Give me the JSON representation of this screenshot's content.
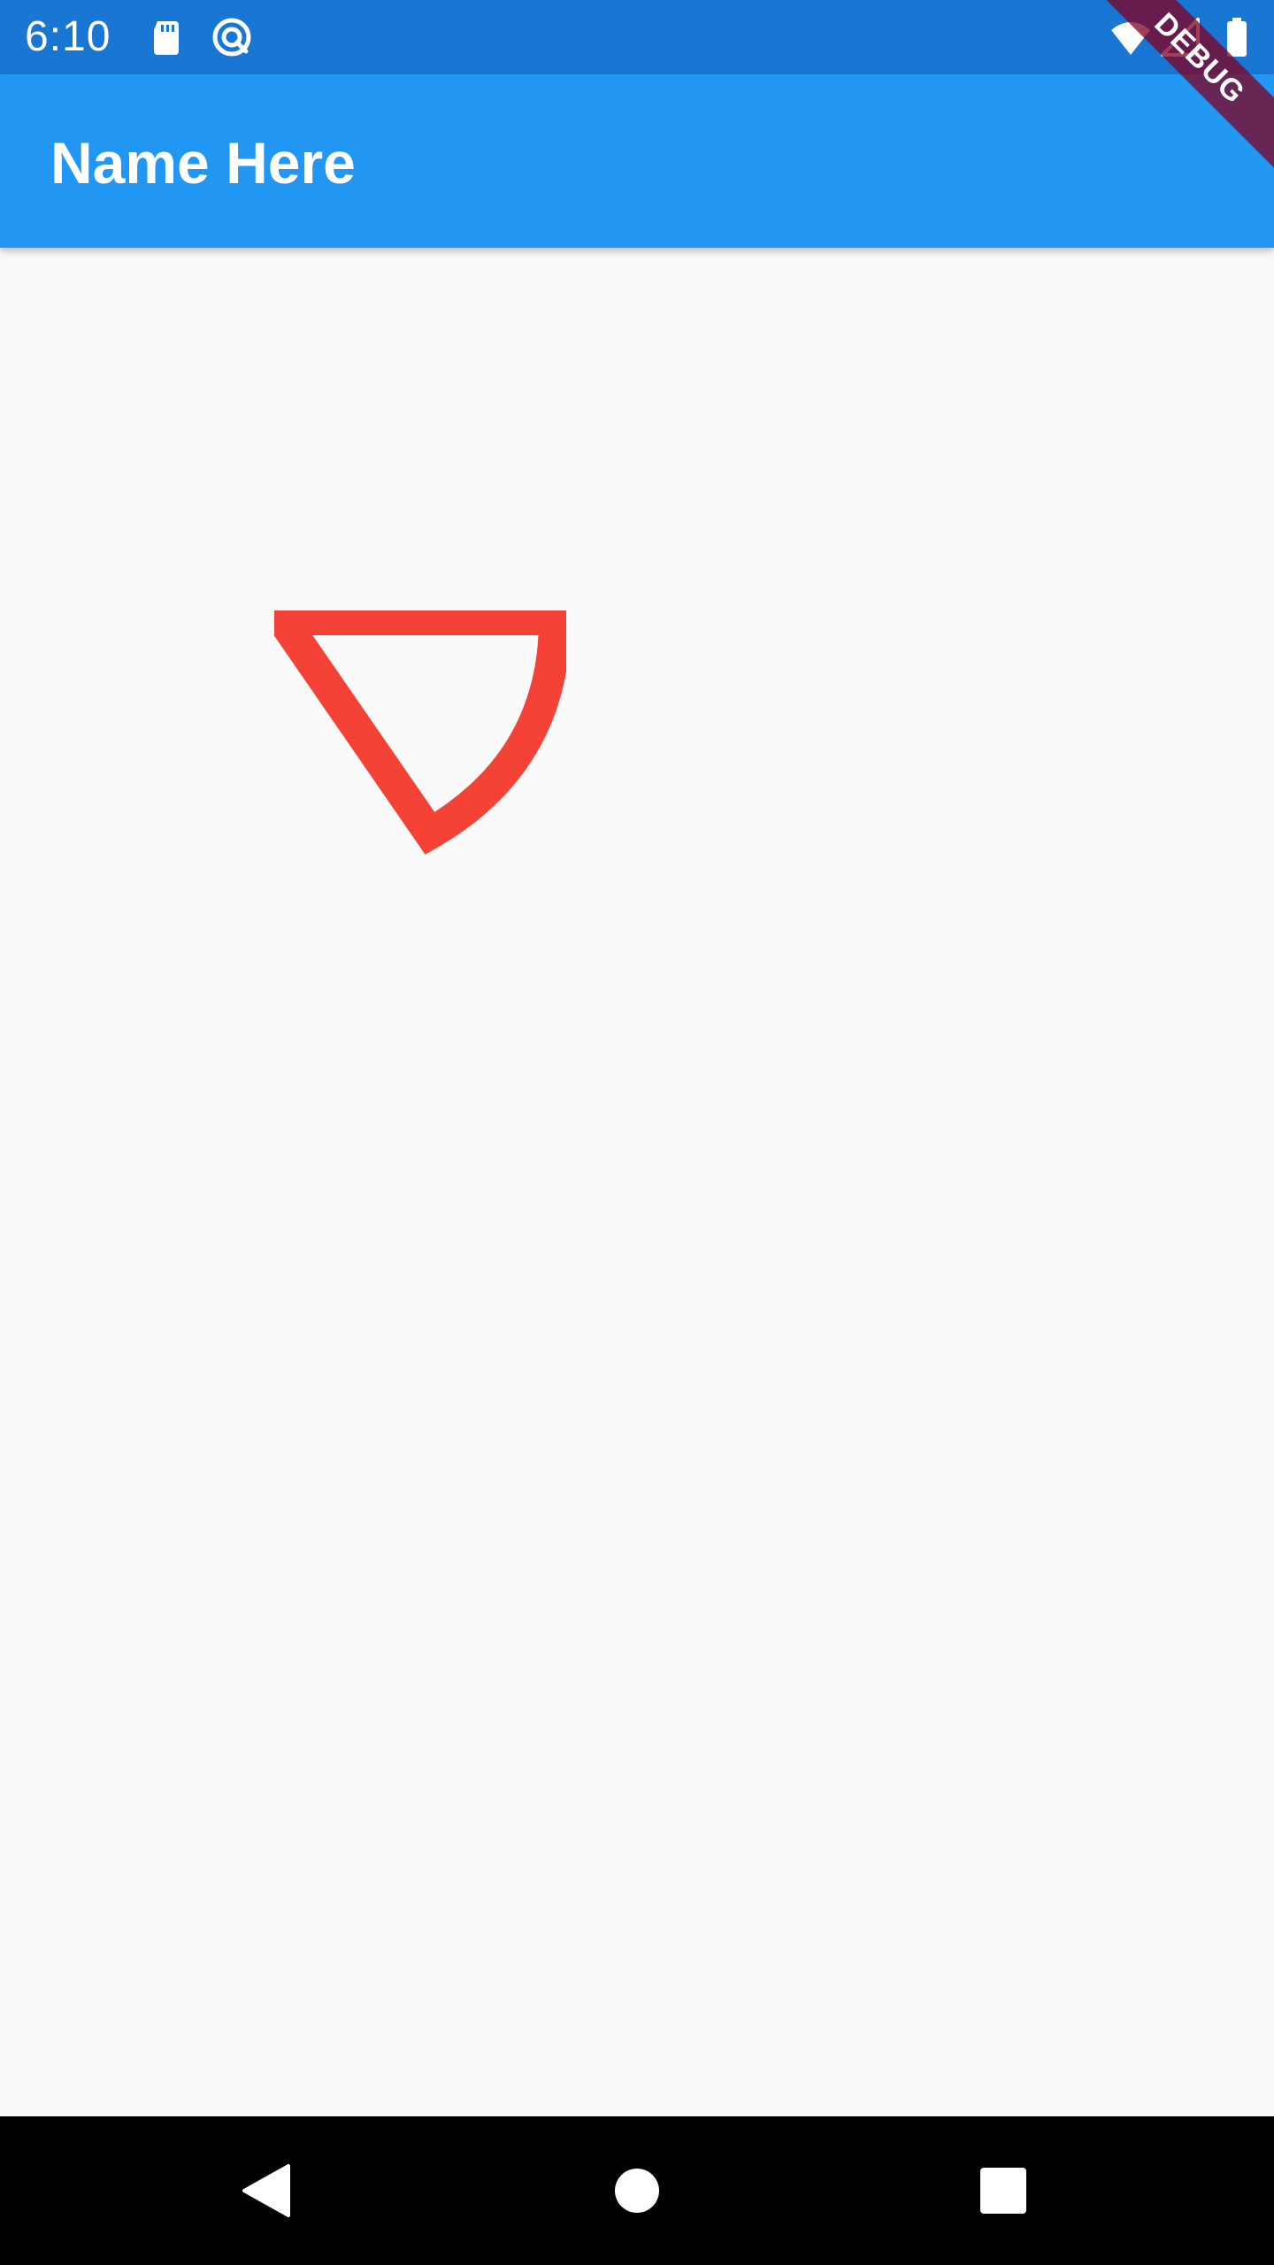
{
  "status_bar": {
    "time": "6:10",
    "background_color": "#1976d2",
    "icons": [
      "sd-card-icon",
      "sync-icon",
      "wifi-icon",
      "signal-icon",
      "battery-icon"
    ]
  },
  "app_bar": {
    "title": "Name Here",
    "background_color": "#2196f3"
  },
  "debug_banner": {
    "label": "DEBUG"
  },
  "canvas": {
    "background_color": "#fafafa",
    "shape_color": "#f44336"
  },
  "nav_bar": {
    "buttons": [
      "back-icon",
      "home-icon",
      "recents-icon"
    ]
  }
}
